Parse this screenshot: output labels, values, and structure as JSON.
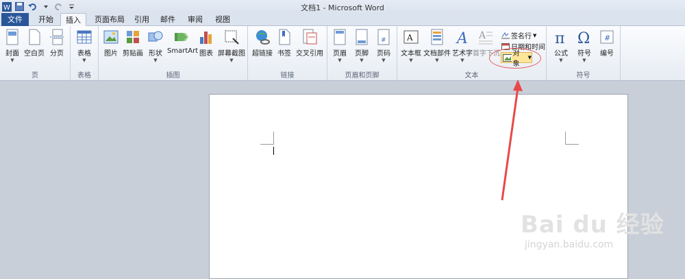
{
  "window": {
    "title": "文档1 - Microsoft Word"
  },
  "tabs": [
    {
      "label": "文件"
    },
    {
      "label": "开始"
    },
    {
      "label": "插入"
    },
    {
      "label": "页面布局"
    },
    {
      "label": "引用"
    },
    {
      "label": "邮件"
    },
    {
      "label": "审阅"
    },
    {
      "label": "视图"
    }
  ],
  "groups": {
    "pages": {
      "label": "页",
      "buttons": [
        "封面",
        "空白页",
        "分页"
      ]
    },
    "tables": {
      "label": "表格",
      "buttons": [
        "表格"
      ]
    },
    "illustrations": {
      "label": "插图",
      "buttons": [
        "图片",
        "剪贴画",
        "形状",
        "SmartArt",
        "图表",
        "屏幕截图"
      ]
    },
    "links": {
      "label": "链接",
      "buttons": [
        "超链接",
        "书签",
        "交叉引用"
      ]
    },
    "header_footer": {
      "label": "页眉和页脚",
      "buttons": [
        "页眉",
        "页脚",
        "页码"
      ]
    },
    "text": {
      "label": "文本",
      "buttons": [
        "文本框",
        "文档部件",
        "艺术字",
        "首字下沉"
      ],
      "small": [
        "签名行",
        "日期和时间",
        "对象"
      ]
    },
    "symbols": {
      "label": "符号",
      "buttons": [
        "公式",
        "符号",
        "编号"
      ]
    }
  },
  "watermark": {
    "brand": "Bai du 经验",
    "url": "jingyan.baidu.com"
  },
  "colors": {
    "file_tab": "#2a5699",
    "annotation": "#e84848",
    "object_highlight": "#fde59a"
  }
}
